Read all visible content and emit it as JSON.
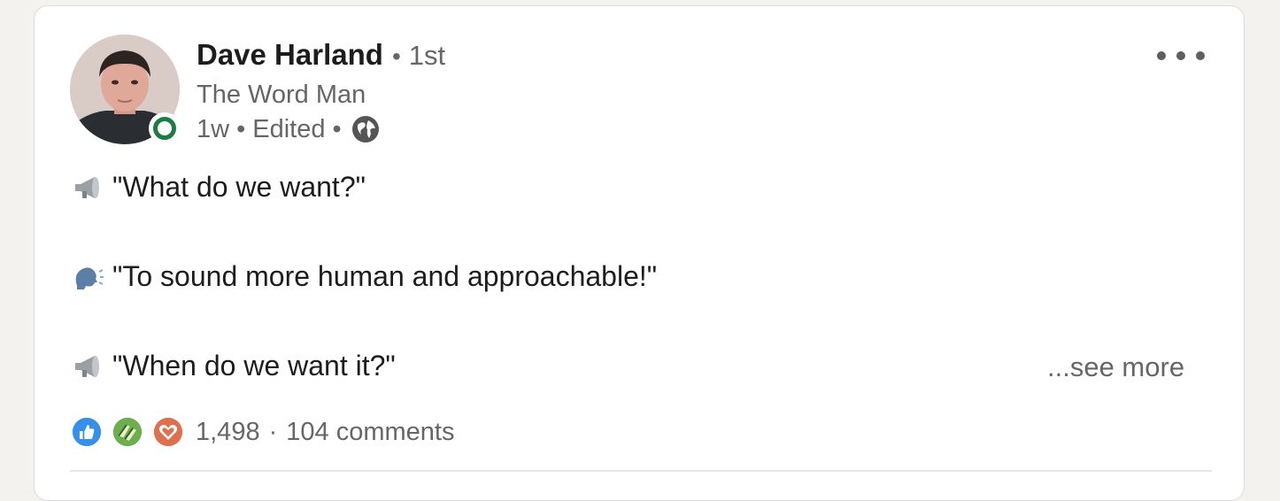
{
  "author": {
    "name": "Dave Harland",
    "connection_degree": "1st",
    "headline": "The Word Man",
    "timestamp": "1w",
    "edited_label": "Edited",
    "online_status_color": "#1b7d3f",
    "visibility_icon": "globe-icon"
  },
  "post": {
    "lines": [
      {
        "icon": "megaphone-icon",
        "text": "\"What do we want?\""
      },
      {
        "icon": "speaking-head-icon",
        "text": "\"To sound more human and approachable!\""
      },
      {
        "icon": "megaphone-icon",
        "text": "\"When do we want it?\""
      }
    ],
    "see_more_label": "...see more"
  },
  "social": {
    "reactions": [
      "like-reaction-icon",
      "celebrate-reaction-icon",
      "love-reaction-icon"
    ],
    "reaction_count": "1,498",
    "separator": "·",
    "comment_count": "104 comments"
  },
  "colors": {
    "like": "#378fe9",
    "celebrate": "#44712e",
    "love": "#df704d"
  }
}
